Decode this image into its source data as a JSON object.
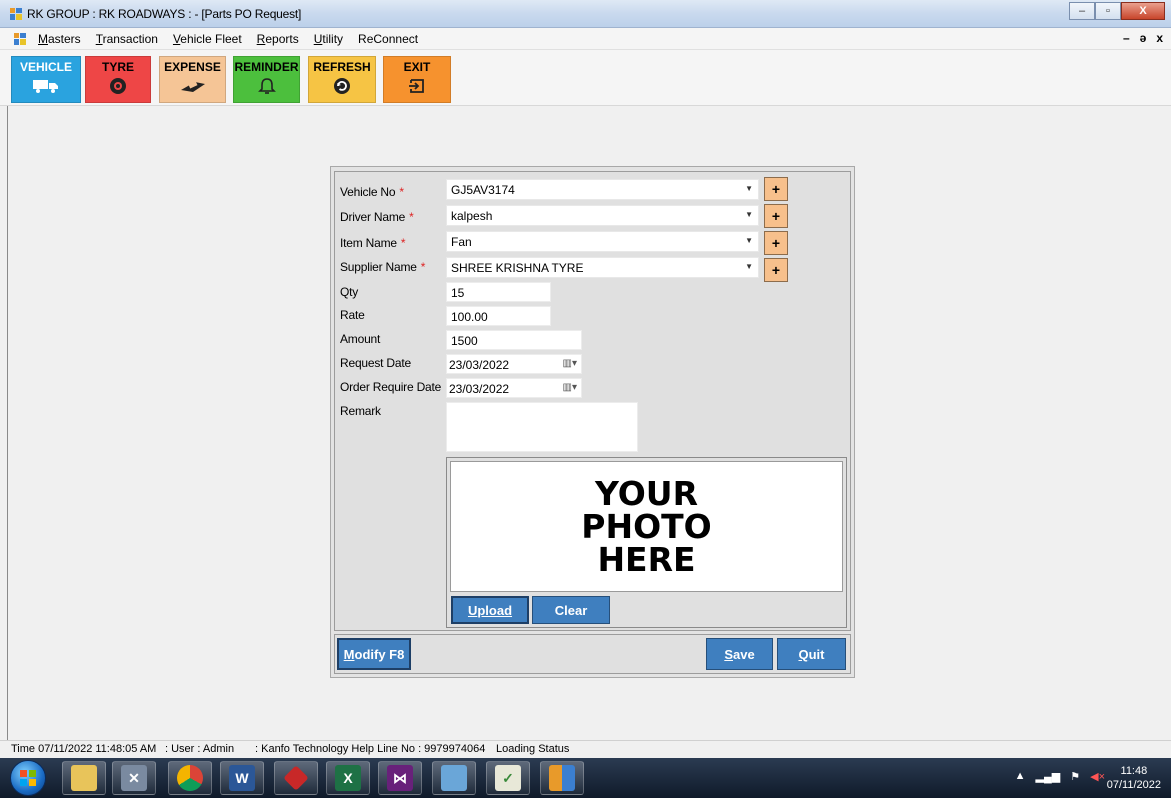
{
  "window": {
    "title": "RK GROUP : RK ROADWAYS : - [Parts PO Request]",
    "controls": {
      "minimize": "–",
      "maximize": "▫",
      "close": "X"
    }
  },
  "menu": {
    "items": [
      {
        "label": "Masters",
        "mnemonic": "M"
      },
      {
        "label": "Transaction",
        "mnemonic": "T"
      },
      {
        "label": "Vehicle Fleet",
        "mnemonic": "V"
      },
      {
        "label": "Reports",
        "mnemonic": "R"
      },
      {
        "label": "Utility",
        "mnemonic": "U"
      },
      {
        "label": "ReConnect",
        "mnemonic": ""
      }
    ],
    "mdi_controls": {
      "minimize": "–",
      "restore": "ǝ",
      "close": "x"
    }
  },
  "toolbar": {
    "vehicle": "VEHICLE",
    "tyre": "TYRE",
    "expense": "EXPENSE",
    "reminder": "REMINDER",
    "refresh": "REFRESH",
    "exit": "EXIT"
  },
  "form": {
    "vehicle_no": {
      "label": "Vehicle No",
      "value": "GJ5AV3174",
      "required": "*"
    },
    "driver_name": {
      "label": "Driver Name",
      "value": "kalpesh",
      "required": "*"
    },
    "item_name": {
      "label": "Item Name",
      "value": "Fan",
      "required": "*"
    },
    "supplier_name": {
      "label": "Supplier Name",
      "value": "SHREE KRISHNA TYRE",
      "required": "*"
    },
    "qty": {
      "label": "Qty",
      "value": "15"
    },
    "rate": {
      "label": "Rate",
      "value": "100.00"
    },
    "amount": {
      "label": "Amount",
      "value": "1500"
    },
    "request_date": {
      "label": "Request Date",
      "value": "23/03/2022"
    },
    "order_require_date": {
      "label": "Order Require Date",
      "value": "23/03/2022"
    },
    "remark": {
      "label": "Remark",
      "value": ""
    },
    "add_button": "+",
    "photo_placeholder": {
      "line1": "YOUR",
      "line2": "PHOTO",
      "line3": "HERE"
    },
    "upload_button": {
      "mnemonic": "U",
      "rest": "pload"
    },
    "clear_button": "Clear",
    "modify_button": {
      "mnemonic": "M",
      "rest": "odify F8"
    },
    "save_button": {
      "mnemonic": "S",
      "rest": "ave"
    },
    "quit_button": {
      "mnemonic": "Q",
      "rest": "uit"
    }
  },
  "status": {
    "time": "Time  07/11/2022 11:48:05 AM",
    "user": ": User : Admin",
    "helpline": ": Kanfo Technology Help Line No : 9979974064",
    "loading": "Loading Status"
  },
  "taskbar": {
    "clock_time": "11:48",
    "clock_date": "07/11/2022"
  },
  "colors": {
    "vehicle": "#2aa3df",
    "tyre": "#ee4646",
    "expense": "#f5c596",
    "reminder": "#4cbf3d",
    "refresh": "#f6c444",
    "exit": "#f6922e",
    "button_blue": "#3f7fbf",
    "plus_button": "#f7c08c",
    "required_mark": "#dd2222"
  }
}
